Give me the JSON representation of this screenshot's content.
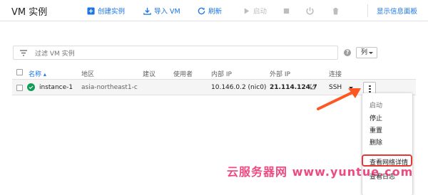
{
  "header": {
    "title": "VM 实例",
    "toolbar": {
      "create": "创建实例",
      "import": "导入 VM",
      "refresh": "刷新",
      "start": "启动",
      "info_panel": "显示信息面板"
    }
  },
  "filter": {
    "placeholder": "过滤 VM 实例",
    "columns_label": "列"
  },
  "table": {
    "columns": [
      "名称",
      "地区",
      "建议",
      "使用者",
      "内部 IP",
      "外部 IP",
      "连接"
    ],
    "rows": [
      {
        "name": "instance-1",
        "zone": "asia-northeast1-c",
        "recommendation": "",
        "used_by": "",
        "internal_ip": "10.146.0.2 (nic0)",
        "external_ip": "21.114.124.7",
        "connect": "SSH",
        "status": "running"
      }
    ]
  },
  "menu": {
    "items": [
      "启动",
      "停止",
      "重置",
      "删除",
      "查看网络详情",
      "查看日志"
    ],
    "highlighted": "查看网络详情"
  },
  "watermark": "云服务器网 www.yuntue.com",
  "colors": {
    "accent": "#1a73e8",
    "status_ok": "#0f9d58",
    "highlight": "#e53935",
    "watermark": "#e91e63"
  }
}
